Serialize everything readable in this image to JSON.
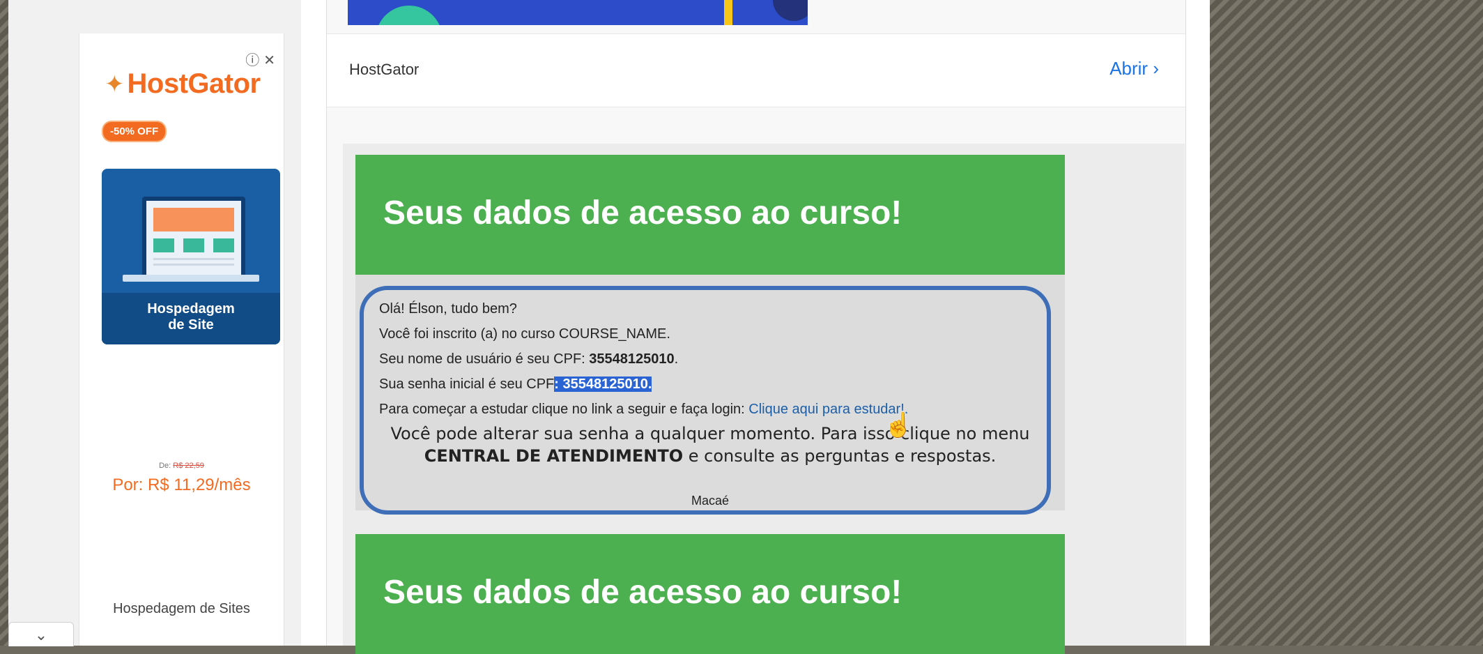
{
  "ad": {
    "info_icon": "ⓘ",
    "close_icon": "✕",
    "brand": "HostGator",
    "badge": "-50% OFF",
    "promo_title_line1": "Hospedagem",
    "promo_title_line2": "de Site",
    "old_price_prefix": "De:",
    "old_price": "R$ 22,59",
    "new_price": "Por: R$ 11,29/mês",
    "footer": "Hospedagem de Sites",
    "colors": {
      "brand_orange": "#f26b21",
      "promo_blue": "#1a5fa3"
    }
  },
  "collapse_icon": "chevron-down-icon",
  "ad_bar": {
    "advertiser": "HostGator",
    "open_label": "Abrir",
    "open_icon": "›"
  },
  "email": {
    "heading": "Seus dados de acesso ao curso!",
    "greeting": "Olá! Élson, tudo bem?",
    "enrolled_line": "Você foi inscrito (a) no curso COURSE_NAME.",
    "username_label": "Seu nome de usuário é seu CPF: ",
    "username_value": "35548125010",
    "password_label": "Sua senha inicial é seu CPF",
    "password_value": ": 35548125010.",
    "login_prefix": "Para começar a estudar clique no link a seguir e faça login: ",
    "login_link": "Clique aqui para estudar!.",
    "change_password_line": "Você pode alterar sua senha a qualquer momento. Para isso clique no menu",
    "central_bold": "CENTRAL DE ATENDIMENTO",
    "central_rest": " e consulte as perguntas e respostas.",
    "city": "Macaé",
    "header_color": "#4caf50"
  }
}
